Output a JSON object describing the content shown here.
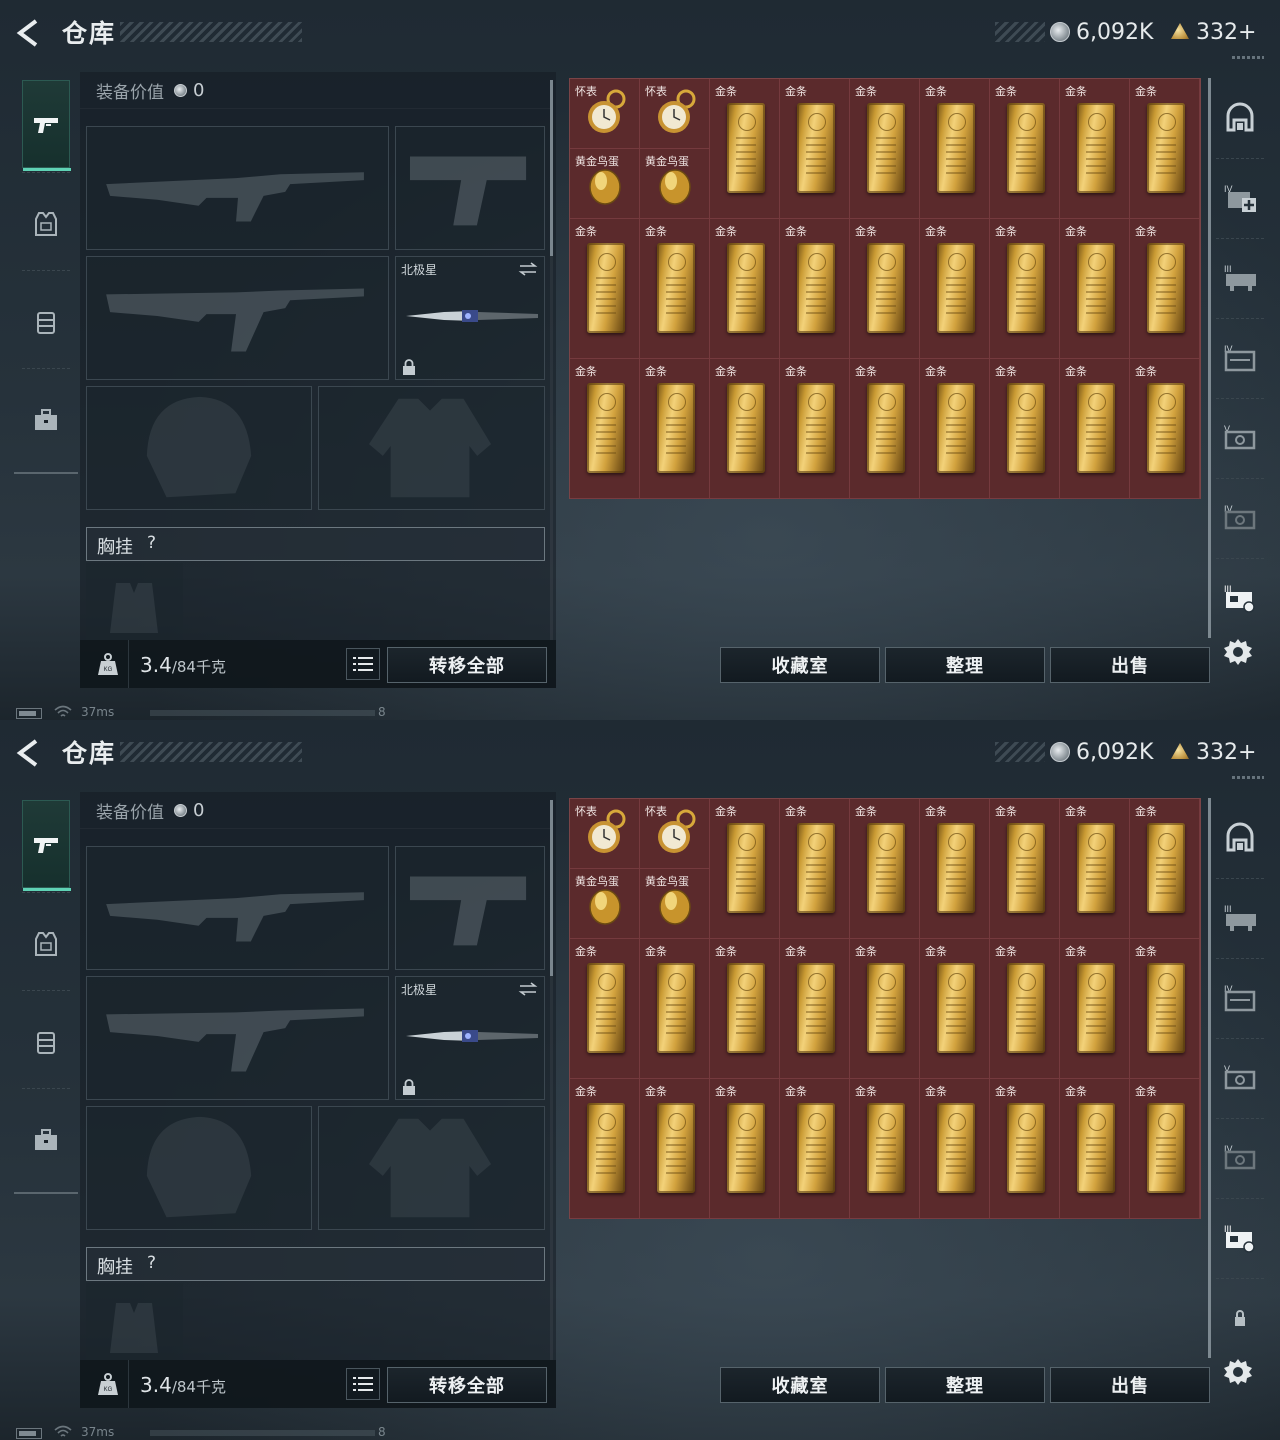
{
  "screens": [
    {
      "header": {
        "title": "仓库",
        "silver": "6,092K",
        "gold": "332+"
      },
      "equip": {
        "value_label": "装备价值",
        "value": "0",
        "melee_label": "北极星",
        "rig_label": "胸挂",
        "rig_hint": "?"
      },
      "weight": {
        "current": "3.4",
        "max": "/84千克"
      },
      "buttons": {
        "transfer_all": "转移全部",
        "collection": "收藏室",
        "sort": "整理",
        "sell": "出售"
      },
      "status": {
        "ping": "37ms",
        "fps": "8"
      },
      "right_nav": [
        "base-icon",
        "iv-plus-icon",
        "iii-case-icon",
        "iv-case-icon",
        "v-case-icon",
        "iv-case-alt-icon",
        "iii-selected-icon",
        "settings-icon"
      ]
    },
    {
      "header": {
        "title": "仓库",
        "silver": "6,092K",
        "gold": "332+"
      },
      "equip": {
        "value_label": "装备价值",
        "value": "0",
        "melee_label": "北极星",
        "rig_label": "胸挂",
        "rig_hint": "?"
      },
      "weight": {
        "current": "3.4",
        "max": "/84千克"
      },
      "buttons": {
        "transfer_all": "转移全部",
        "collection": "收藏室",
        "sort": "整理",
        "sell": "出售"
      },
      "status": {
        "ping": "37ms",
        "fps": "8"
      },
      "right_nav": [
        "base-icon",
        "iii-case-icon",
        "iv-case-icon",
        "v-case-icon",
        "iv-case-alt-icon",
        "iii-selected-icon",
        "lock-icon",
        "settings-icon"
      ]
    }
  ],
  "storage": {
    "small_items": [
      {
        "label": "怀表",
        "icon": "pocket-watch-icon"
      },
      {
        "label": "怀表",
        "icon": "pocket-watch-icon"
      },
      {
        "label": "黄金鸟蛋",
        "icon": "golden-egg-icon"
      },
      {
        "label": "黄金鸟蛋",
        "icon": "golden-egg-icon"
      }
    ],
    "gold_bar_label": "金条",
    "rows": 3,
    "cols": 9
  },
  "colors": {
    "grid_bg": "#5b2a2c",
    "accent": "#5fd3b5",
    "gold": "#d3a33e"
  }
}
